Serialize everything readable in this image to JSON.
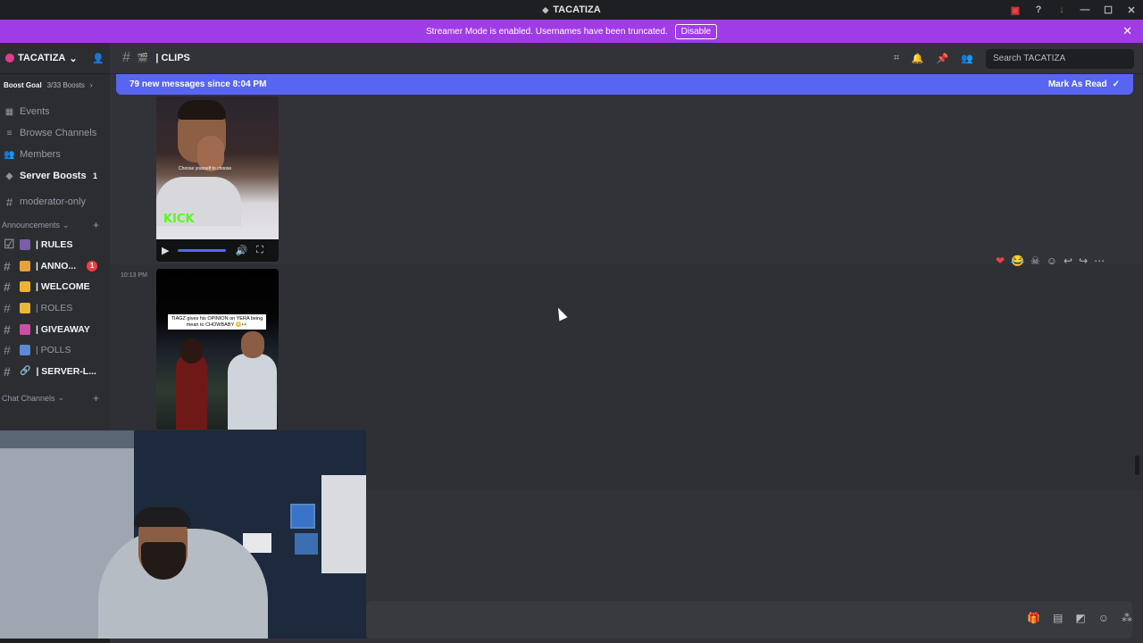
{
  "window": {
    "title": "TACATIZA"
  },
  "banner": {
    "text": "Streamer Mode is enabled. Usernames have been truncated.",
    "button": "Disable"
  },
  "server": {
    "name": "TACATIZA",
    "boost_goal": "Boost Goal",
    "boost_count": "3/33 Boosts"
  },
  "nav": [
    {
      "label": "Events"
    },
    {
      "label": "Browse Channels"
    },
    {
      "label": "Members"
    },
    {
      "label": "Server Boosts",
      "badge": "1"
    },
    {
      "label": "moderator-only"
    }
  ],
  "categories": {
    "announcements": "Announcements",
    "chat": "Chat Channels"
  },
  "channels": [
    {
      "label": "| RULES"
    },
    {
      "label": "| ANNO...",
      "badge": "1"
    },
    {
      "label": "| WELCOME"
    },
    {
      "label": "| ROLES"
    },
    {
      "label": "| GIVEAWAY"
    },
    {
      "label": "| POLLS"
    },
    {
      "label": "| SERVER-L..."
    }
  ],
  "header": {
    "channel": "| CLIPS",
    "search_placeholder": "Search TACATIZA"
  },
  "new_messages": {
    "text": "79 new messages since 8:04 PM",
    "action": "Mark As Read"
  },
  "messages": [
    {
      "video_overlay": "KICK",
      "video_caption": "Choose yourself to choose"
    },
    {
      "timestamp": "10:13 PM",
      "video_caption": "TIAGZ gives his OPINION on YERA being mean to CHOWBABY 😳👀"
    }
  ],
  "colors": {
    "accent": "#5865f2",
    "streamer_banner": "#a03be8",
    "kick_green": "#53fc18"
  }
}
